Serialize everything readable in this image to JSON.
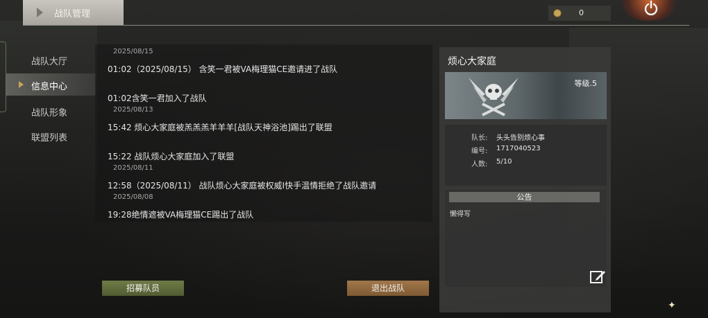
{
  "header": {
    "title": "战队管理",
    "currency_value": "0"
  },
  "sidebar": {
    "items": [
      {
        "label": "战队大厅",
        "active": false
      },
      {
        "label": "信息中心",
        "active": true
      },
      {
        "label": "战队形象",
        "active": false
      },
      {
        "label": "联盟列表",
        "active": false
      }
    ]
  },
  "messages": {
    "d1": "2025/08/15",
    "m1": "01:02（2025/08/15） 含笑一君被VA梅理猫CE邀请进了战队",
    "m2": "01:02含笑一君加入了战队",
    "d2": "2025/08/13",
    "m3": "15:42 烦心大家庭被羔羔羔羊羊羊[战队天神浴池]踢出了联盟",
    "m4": "15:22 战队烦心大家庭加入了联盟",
    "d3": "2025/08/11",
    "m5": "12:58（2025/08/11） 战队烦心大家庭被权威I快手温情拒绝了战队邀请",
    "d4": "2025/08/08",
    "m6": "19:28绝情遮被VA梅理猫CE踢出了战队"
  },
  "buttons": {
    "recruit": "招募队员",
    "quit": "退出战队"
  },
  "team": {
    "name": "烦心大家庭",
    "level": "等级.5",
    "captain_label": "队长:",
    "captain": "头头告别烦心事",
    "id_label": "编号:",
    "id": "1717040523",
    "members_label": "人数:",
    "members": "5/10",
    "notice_title": "公告",
    "notice_text": "懒得写"
  },
  "icons": {
    "coin": "coin-icon",
    "power": "power-icon",
    "edit": "edit-icon",
    "emblem": "skull-emblem-icon"
  },
  "colors": {
    "accent_gold": "#c7a35a",
    "recruit_green": "#6f7b46",
    "quit_orange": "#a1774a"
  }
}
